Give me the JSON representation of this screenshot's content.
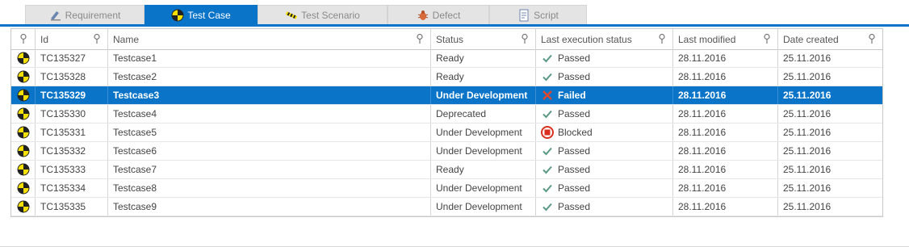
{
  "tabs": [
    {
      "label": "Requirement",
      "icon": "requirement-icon",
      "active": false
    },
    {
      "label": "Test Case",
      "icon": "test-case-icon",
      "active": true
    },
    {
      "label": "Test Scenario",
      "icon": "test-scenario-icon",
      "active": false
    },
    {
      "label": "Defect",
      "icon": "bug-icon",
      "active": false
    },
    {
      "label": "Script",
      "icon": "script-icon",
      "active": false
    }
  ],
  "colors": {
    "accent": "#0a74c9",
    "passed": "#5a9a82",
    "failed": "#e0472b",
    "blocked": "#d9301f"
  },
  "grid": {
    "columns": [
      "Id",
      "Name",
      "Status",
      "Last execution status",
      "Last modified",
      "Date created"
    ],
    "rows": [
      {
        "id": "TC135327",
        "name": "Testcase1",
        "status": "Ready",
        "exec": "Passed",
        "exec_icon": "check-icon",
        "modified": "28.11.2016",
        "created": "25.11.2016",
        "selected": false
      },
      {
        "id": "TC135328",
        "name": "Testcase2",
        "status": "Ready",
        "exec": "Passed",
        "exec_icon": "check-icon",
        "modified": "28.11.2016",
        "created": "25.11.2016",
        "selected": false
      },
      {
        "id": "TC135329",
        "name": "Testcase3",
        "status": "Under Development",
        "exec": "Failed",
        "exec_icon": "cross-icon",
        "modified": "28.11.2016",
        "created": "25.11.2016",
        "selected": true
      },
      {
        "id": "TC135330",
        "name": "Testcase4",
        "status": "Deprecated",
        "exec": "Passed",
        "exec_icon": "check-icon",
        "modified": "28.11.2016",
        "created": "25.11.2016",
        "selected": false
      },
      {
        "id": "TC135331",
        "name": "Testcase5",
        "status": "Under Development",
        "exec": "Blocked",
        "exec_icon": "blocked-icon",
        "modified": "28.11.2016",
        "created": "25.11.2016",
        "selected": false
      },
      {
        "id": "TC135332",
        "name": "Testcase6",
        "status": "Under Development",
        "exec": "Passed",
        "exec_icon": "check-icon",
        "modified": "28.11.2016",
        "created": "25.11.2016",
        "selected": false
      },
      {
        "id": "TC135333",
        "name": "Testcase7",
        "status": "Ready",
        "exec": "Passed",
        "exec_icon": "check-icon",
        "modified": "28.11.2016",
        "created": "25.11.2016",
        "selected": false
      },
      {
        "id": "TC135334",
        "name": "Testcase8",
        "status": "Under Development",
        "exec": "Passed",
        "exec_icon": "check-icon",
        "modified": "28.11.2016",
        "created": "25.11.2016",
        "selected": false
      },
      {
        "id": "TC135335",
        "name": "Testcase9",
        "status": "Under Development",
        "exec": "Passed",
        "exec_icon": "check-icon",
        "modified": "28.11.2016",
        "created": "25.11.2016",
        "selected": false
      }
    ]
  }
}
